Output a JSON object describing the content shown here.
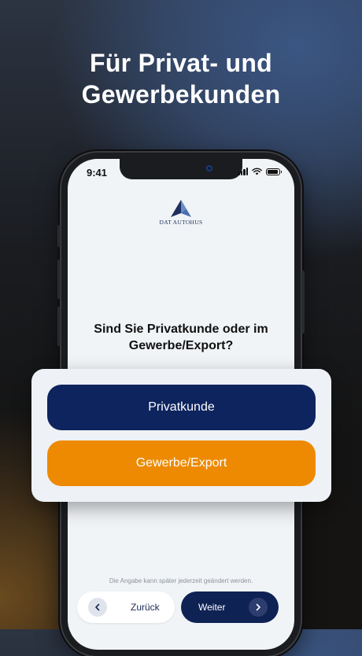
{
  "headline": {
    "line1": "Für Privat- und",
    "line2": "Gewerbekunden"
  },
  "status_bar": {
    "time": "9:41",
    "icons": [
      "signal-icon",
      "wifi-icon",
      "battery-icon"
    ]
  },
  "brand": {
    "name": "DAT AUTOHUS",
    "logo_icon": "triangle-logo-icon",
    "color": "#1d2f5e"
  },
  "question": {
    "line1": "Sind Sie Privatkunde oder im",
    "line2": "Gewerbe/Export?"
  },
  "options": [
    {
      "label": "Privatkunde",
      "color": "#0e245e"
    },
    {
      "label": "Gewerbe/Export",
      "color": "#ed8a02"
    }
  ],
  "hint": "Die Angabe kann später jederzeit geändert werden.",
  "nav": {
    "back_label": "Zurück",
    "back_icon": "chevron-left-icon",
    "next_label": "Weiter",
    "next_icon": "chevron-right-icon"
  }
}
